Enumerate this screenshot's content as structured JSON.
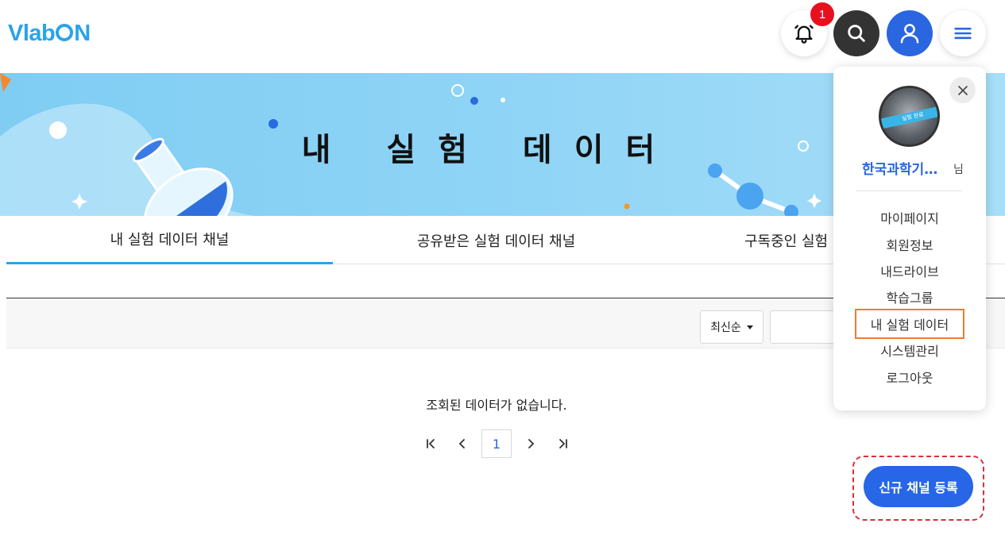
{
  "header": {
    "logo": "VlabON",
    "notification_count": "1"
  },
  "banner": {
    "title": "내 실험 데이터"
  },
  "tabs": [
    {
      "label": "내 실험 데이터 채널",
      "active": true
    },
    {
      "label": "공유받은 실험 데이터 채널",
      "active": false
    },
    {
      "label": "구독중인 실험 데",
      "active": false
    }
  ],
  "toolbar": {
    "sort_selected": "최신순",
    "search_value": ""
  },
  "empty_message": "조회된 데이터가 없습니다.",
  "pagination": {
    "first_label": "|<",
    "prev_label": "<",
    "current_page": "1",
    "next_label": ">",
    "last_label": ">|"
  },
  "register_button_label": "신규 채널 등록",
  "user_menu": {
    "username": "한국과학기…",
    "suffix": "님",
    "avatar_text": "실험 완료",
    "items": [
      {
        "label": "마이페이지"
      },
      {
        "label": "회원정보"
      },
      {
        "label": "내드라이브"
      },
      {
        "label": "학습그룹"
      },
      {
        "label": "내 실험 데이터",
        "highlighted": true
      },
      {
        "label": "시스템관리"
      },
      {
        "label": "로그아웃"
      }
    ]
  },
  "colors": {
    "accent": "#2aa3e8",
    "primary_button": "#2766e6",
    "badge": "#e8101f",
    "highlight_outline": "#ef7d31",
    "dashed_outline": "#d9303a"
  },
  "icons": [
    "bell-icon",
    "search-icon",
    "user-icon",
    "hamburger-icon",
    "close-icon",
    "chevron-first-icon",
    "chevron-left-icon",
    "chevron-right-icon",
    "chevron-last-icon"
  ]
}
